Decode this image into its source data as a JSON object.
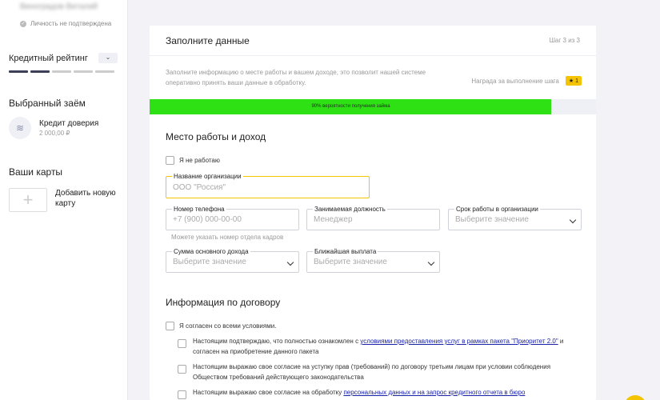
{
  "sidebar": {
    "user_name": "Виноградов Виталий",
    "verify_status": "Личность не подтверждена",
    "rating": {
      "label": "Кредитный рейтинг",
      "toggle": "⌄",
      "bars_total": 5,
      "bars_active": 2
    },
    "selected_loan": {
      "title": "Выбранный заём",
      "name": "Кредит доверия",
      "amount": "2 000,00 ₽"
    },
    "cards": {
      "title": "Ваши карты",
      "add_label": "Добавить новую карту",
      "add_symbol": "+"
    }
  },
  "panel": {
    "title": "Заполните данные",
    "step": "Шаг 3 из 3",
    "info": "Заполните информацию о месте работы и вашем доходе, это позволит нашей системе оперативно принять ваши данные в обработку.",
    "reward_label": "Награда за выполнение шага",
    "reward_badge": "★ 1",
    "progress": {
      "percent": 90,
      "text": "90% вероятности получения займа"
    }
  },
  "work": {
    "title": "Место работы и доход",
    "not_working": "Я не работаю",
    "org_label": "Название организации",
    "org_placeholder": "ООО \"Россия\"",
    "phone_label": "Номер телефона",
    "phone_placeholder": "+7 (900) 000-00-00",
    "phone_hint": "Можете указать номер отдела кадров",
    "position_label": "Занимаемая должность",
    "position_placeholder": "Менеджер",
    "tenure_label": "Срок работы в организации",
    "tenure_value": "Выберите значение",
    "income_label": "Сумма основного дохода",
    "income_value": "Выберите значение",
    "payout_label": "Ближайшая выплата",
    "payout_value": "Выберите значение"
  },
  "contract": {
    "title": "Информация по договору",
    "agree_all": "Я согласен со всеми условиями.",
    "c1_pre": "Настоящим подтверждаю, что полностью ознакомлен с ",
    "c1_link": "условиями предоставления услуг в рамках пакета \"Приоритет 2.0\"",
    "c1_post": " и согласен на приобретение данного пакета",
    "c2": "Настоящим выражаю свое согласие на уступку прав (требований) по договору третьим лицам при условии соблюдения Обществом требований действующего законодательства",
    "c3_pre": "Настоящим выражаю свое согласие на обработку ",
    "c3_link": "персональных данных и на запрос кредитного отчета в бюро"
  },
  "colors": {
    "accent": "#f5c400",
    "progress": "#2ee114",
    "link": "#1a22a8"
  }
}
